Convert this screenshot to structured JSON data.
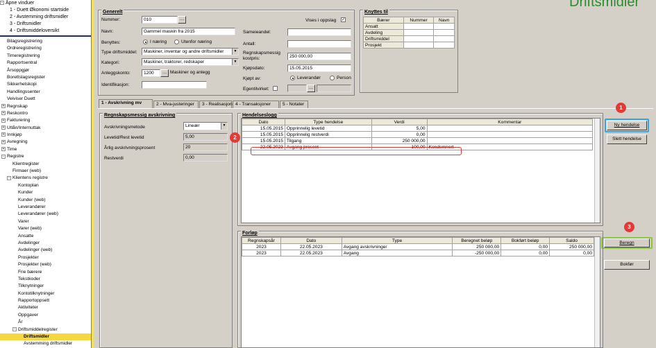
{
  "title": "Driftsmidler",
  "nav": {
    "open_windows": {
      "label": "Åpne vinduer",
      "items": [
        "1 - Duett Økonomi startside",
        "2 - Avstemming driftsmidler",
        "3 - Driftsmidler",
        "4 - Driftsmiddeloversikt"
      ]
    },
    "items": [
      {
        "label": "Bilagsregistrering",
        "d": 0,
        "pm": ""
      },
      {
        "label": "Ordreregistrering",
        "d": 0,
        "pm": ""
      },
      {
        "label": "Timeregistrering",
        "d": 0,
        "pm": ""
      },
      {
        "label": "Rapportsentral",
        "d": 0,
        "pm": ""
      },
      {
        "label": "Årsoppgjør",
        "d": 0,
        "pm": ""
      },
      {
        "label": "Borettslagsregister",
        "d": 0,
        "pm": ""
      },
      {
        "label": "Sikkerhetskopi",
        "d": 0,
        "pm": ""
      },
      {
        "label": "Handlingssenter",
        "d": 0,
        "pm": ""
      },
      {
        "label": "Veiviser Duett",
        "d": 0,
        "pm": ""
      },
      {
        "label": "Regnskap",
        "d": 0,
        "pm": "+"
      },
      {
        "label": "Reskontro",
        "d": 0,
        "pm": "+"
      },
      {
        "label": "Fakturering",
        "d": 0,
        "pm": "+"
      },
      {
        "label": "Utlån/Internuttak",
        "d": 0,
        "pm": "+"
      },
      {
        "label": "Innkjøp",
        "d": 0,
        "pm": "+"
      },
      {
        "label": "Avregning",
        "d": 0,
        "pm": "+"
      },
      {
        "label": "Time",
        "d": 0,
        "pm": "+"
      },
      {
        "label": "Registre",
        "d": 0,
        "pm": "-"
      },
      {
        "label": "Klientregister",
        "d": 1,
        "pm": ""
      },
      {
        "label": "Firmaer (web)",
        "d": 1,
        "pm": ""
      },
      {
        "label": "Klientens registre",
        "d": 1,
        "pm": "-"
      },
      {
        "label": "Kontoplan",
        "d": 2,
        "pm": ""
      },
      {
        "label": "Kunder",
        "d": 2,
        "pm": ""
      },
      {
        "label": "Kunder (web)",
        "d": 2,
        "pm": ""
      },
      {
        "label": "Leverandører",
        "d": 2,
        "pm": ""
      },
      {
        "label": "Leverandører (web)",
        "d": 2,
        "pm": ""
      },
      {
        "label": "Varer",
        "d": 2,
        "pm": ""
      },
      {
        "label": "Varer (web)",
        "d": 2,
        "pm": ""
      },
      {
        "label": "Ansatte",
        "d": 2,
        "pm": ""
      },
      {
        "label": "Avdelinger",
        "d": 2,
        "pm": ""
      },
      {
        "label": "Avdelinger (web)",
        "d": 2,
        "pm": ""
      },
      {
        "label": "Prosjekter",
        "d": 2,
        "pm": ""
      },
      {
        "label": "Prosjekter (web)",
        "d": 2,
        "pm": ""
      },
      {
        "label": "Frie bærere",
        "d": 2,
        "pm": ""
      },
      {
        "label": "Tekstkoder",
        "d": 2,
        "pm": ""
      },
      {
        "label": "Tilknytninger",
        "d": 2,
        "pm": ""
      },
      {
        "label": "Kontotilknytninger",
        "d": 2,
        "pm": ""
      },
      {
        "label": "Rapportoppsett",
        "d": 2,
        "pm": ""
      },
      {
        "label": "Aktiviteter",
        "d": 2,
        "pm": ""
      },
      {
        "label": "Oppgaver",
        "d": 2,
        "pm": ""
      },
      {
        "label": "År",
        "d": 2,
        "pm": ""
      },
      {
        "label": "Driftsmiddelregister",
        "d": 2,
        "pm": "-"
      },
      {
        "label": "Driftsmidler",
        "d": 3,
        "pm": "",
        "sel": true
      },
      {
        "label": "Avstemming driftsmidler",
        "d": 3,
        "pm": ""
      },
      {
        "label": "Driftsmiddeloversikt",
        "d": 3,
        "pm": ""
      }
    ]
  },
  "generelt": {
    "title": "Generelt",
    "nummer_label": "Nummer:",
    "nummer": "010",
    "navn_label": "Navn:",
    "navn": "Gammel maskin fra 2015",
    "benyttes_label": "Benyttes:",
    "i_naering": "I næring",
    "utenfor_naering": "Utenfor næring",
    "type_label": "Type driftsmiddel:",
    "type": "Maskiner, inventar og andre driftsmidler",
    "kategori_label": "Kategori:",
    "kategori": "Maskiner, traktorer, redskaper",
    "anleggskonto_label": "Anleggskonto:",
    "anleggskonto": "1200",
    "anleggskonto_navn": "Maskiner og anlegg",
    "identifikasjon_label": "Identifikasjon:",
    "vises_label": "Vises i oppslag",
    "vises_checked": "✓",
    "sameieandel_label": "Sameieandel:",
    "antall_label": "Antall:",
    "kostpris_label": "Regnskapsmessig kostpris:",
    "kostpris": "250 000,00",
    "kjopsdato_label": "Kjøpsdato:",
    "kjopsdato": "15.05.2015",
    "kjopt_av_label": "Kjøpt av:",
    "leverandor": "Leverandør",
    "person": "Person",
    "egentilvirket_label": "Egentilvirket:"
  },
  "knyttes": {
    "title": "Knyttes til",
    "headers": [
      "Bærer",
      "Nummer",
      "Navn"
    ],
    "rows": [
      "Ansatt",
      "Avdeling",
      "Driftsmiddel",
      "Prosjekt"
    ]
  },
  "tabs": [
    "1 - Avskrivning mv",
    "2 - Mva-justeringer",
    "3 - Realisasjon",
    "4 - Transaksjoner",
    "5 - Notater"
  ],
  "avskrivning": {
    "title": "Regnskapsmessig avskrivning",
    "metode_label": "Avskrivningsmetode",
    "metode": "Lineær",
    "levetid_label": "Levetid/Rest levetid",
    "levetid": "5,00",
    "prosent_label": "Årlig avskrivningsprosent",
    "prosent": "20",
    "restverdi_label": "Restverdi",
    "restverdi": "0,00"
  },
  "hendelseslogg": {
    "title": "Hendelseslogg",
    "headers": [
      "Dato",
      "Type hendelse",
      "Verdi",
      "Kommentar"
    ],
    "rows": [
      [
        "15.05.2015",
        "Opprinnelig levetid",
        "5,00",
        ""
      ],
      [
        "15.05.2015",
        "Opprinnelig restverdi",
        "0,00",
        ""
      ],
      [
        "15.05.2015",
        "Tilgang",
        "250 000,00",
        ""
      ],
      [
        "22.05.2023",
        "Avgang prosent",
        "100,00",
        "Kondemnert"
      ]
    ]
  },
  "buttons": {
    "ny_hendelse": "Ny hendelse",
    "slett_hendelse": "Slett hendelse",
    "beregn": "Beregn",
    "bokfor": "Bokfør"
  },
  "forlop": {
    "title": "Forløp",
    "headers": [
      "Regnskapsår",
      "Dato",
      "Type",
      "Beregnet beløp",
      "Bokført beløp",
      "Saldo"
    ],
    "rows": [
      [
        "2023",
        "22.05.2023",
        "Avgang avskrivninger",
        "250 000,00",
        "0,00",
        "250 000,00"
      ],
      [
        "2023",
        "22.05.2023",
        "Avgang",
        "-250 000,00",
        "0,00",
        "0,00"
      ]
    ]
  },
  "callouts": [
    "1",
    "2",
    "3"
  ],
  "colors": {
    "accent_blue": "#3aa3e3",
    "accent_green": "#8fc63f",
    "accent_red": "#e53935",
    "nav_sel": "#f5d742"
  }
}
